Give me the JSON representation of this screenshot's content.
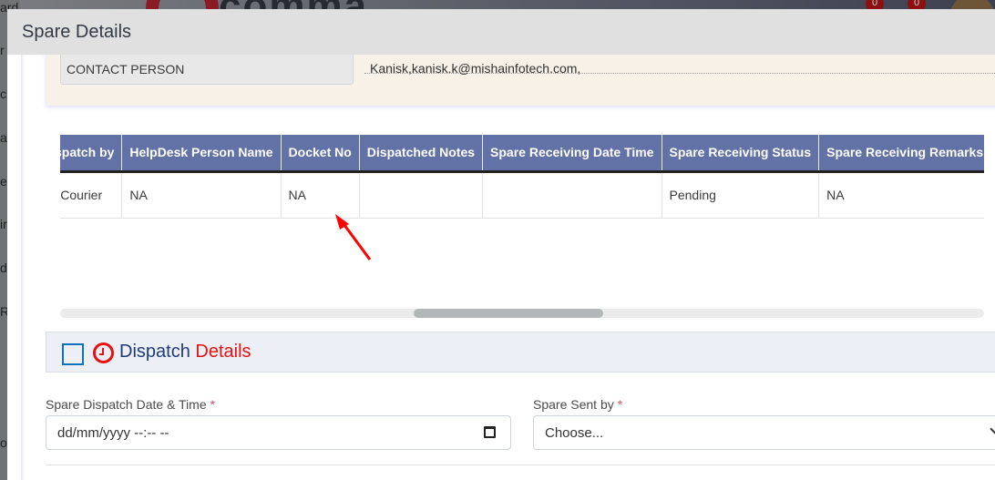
{
  "background": {
    "logo_text": "comma",
    "badges": [
      "0",
      "0"
    ],
    "sidebar_fragments": [
      "ard",
      "r",
      "ci",
      "a",
      "e",
      "ir",
      "d",
      "Re",
      "ol"
    ]
  },
  "modal": {
    "title": "Spare Details"
  },
  "contact": {
    "label": "CONTACT PERSON",
    "value": "Kanisk,kanisk.k@mishainfotech.com,"
  },
  "table": {
    "columns": [
      "Dispatch by",
      "HelpDesk Person Name",
      "Docket No",
      "Dispatched Notes",
      "Spare Receiving Date Time",
      "Spare Receiving Status",
      "Spare Receiving Remarks"
    ],
    "rows": [
      [
        "By Courier",
        "NA",
        "NA",
        "",
        "",
        "Pending",
        "NA"
      ]
    ],
    "scroll_position_fraction": 0.38
  },
  "dispatch_section": {
    "title_part1": "Dispatch",
    "title_part2": "Details",
    "checked": false
  },
  "form": {
    "dispatch_date_label": "Spare Dispatch Date & Time",
    "dispatch_date_placeholder": "dd/mm/yyyy --:-- --",
    "sent_by_label": "Spare Sent by",
    "sent_by_value": "Choose...",
    "required_mark": "*"
  },
  "colors": {
    "table_header_bg": "#6272a6",
    "section_title_blue": "#1f3c78",
    "accent_red": "#e81010",
    "checkbox_blue": "#1272b8",
    "contact_card_bg": "#f7f1e8"
  }
}
